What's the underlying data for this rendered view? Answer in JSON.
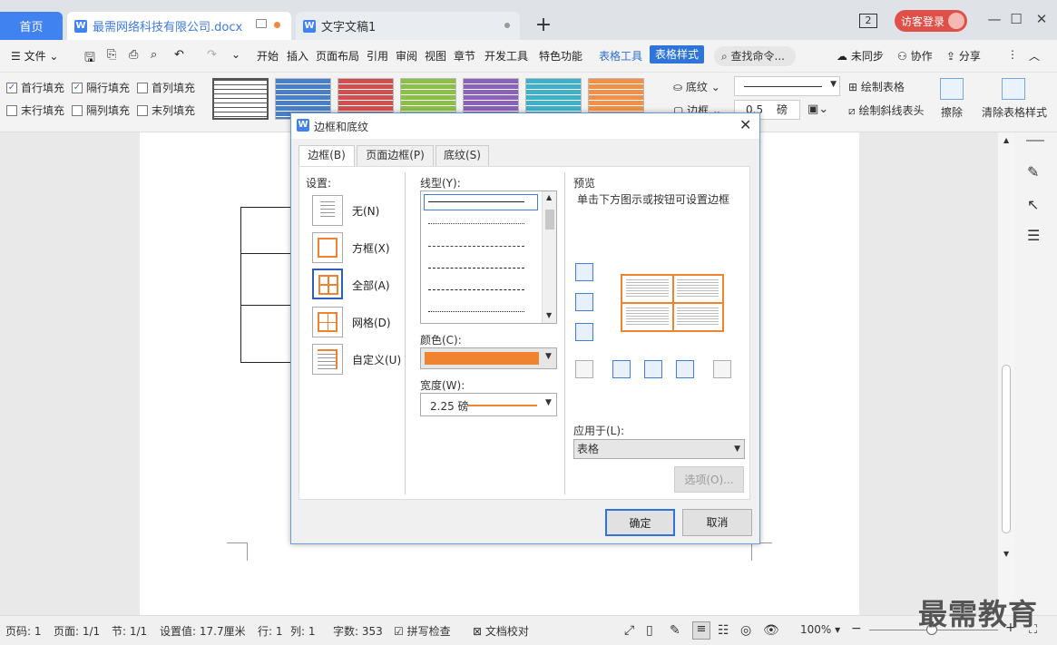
{
  "tabs": {
    "home": "首页",
    "doc1": "最需网络科技有限公司.docx",
    "doc2": "文字文稿1"
  },
  "titlebar": {
    "badge": "2",
    "login": "访客登录"
  },
  "menu": {
    "file": "文件",
    "items": [
      "开始",
      "插入",
      "页面布局",
      "引用",
      "审阅",
      "视图",
      "章节",
      "开发工具",
      "特色功能"
    ],
    "table_tools": "表格工具",
    "table_style": "表格样式",
    "search": "查找命令...",
    "unsync": "未同步",
    "collab": "协作",
    "share": "分享"
  },
  "ribbon": {
    "checks": [
      {
        "label": "首行填充",
        "checked": true
      },
      {
        "label": "隔行填充",
        "checked": true
      },
      {
        "label": "首列填充",
        "checked": false
      },
      {
        "label": "末行填充",
        "checked": false
      },
      {
        "label": "隔列填充",
        "checked": false
      },
      {
        "label": "末列填充",
        "checked": false
      }
    ],
    "shading": "底纹",
    "border": "边框",
    "width": "0.5",
    "unit": "磅",
    "draw_table": "绘制表格",
    "draw_diag": "绘制斜线表头",
    "erase": "擦除",
    "clear_style": "清除表格样式",
    "swatch_colors": [
      "#6b6b6b",
      "#4a7fc8",
      "#d05050",
      "#8cbf4a",
      "#8a62b8",
      "#3fb0c8",
      "#f0904a"
    ]
  },
  "dialog": {
    "title": "边框和底纹",
    "tabs": [
      "边框(B)",
      "页面边框(P)",
      "底纹(S)"
    ],
    "settings_label": "设置:",
    "settings": [
      "无(N)",
      "方框(X)",
      "全部(A)",
      "网格(D)",
      "自定义(U)"
    ],
    "style_label": "线型(Y):",
    "color_label": "颜色(C):",
    "color": "#f0832f",
    "width_label": "宽度(W):",
    "width": "2.25 磅",
    "preview_label": "预览",
    "preview_hint": "单击下方图示或按钮可设置边框",
    "apply_label": "应用于(L):",
    "apply_value": "表格",
    "options": "选项(O)...",
    "ok": "确定",
    "cancel": "取消"
  },
  "status": {
    "page": "页码: 1",
    "pages": "页面: 1/1",
    "section": "节: 1/1",
    "setting": "设置值: 17.7厘米",
    "row": "行: 1",
    "col": "列: 1",
    "words": "字数: 353",
    "spell": "拼写检查",
    "proof": "文档校对",
    "zoom": "100%"
  },
  "watermark": "最需教育"
}
